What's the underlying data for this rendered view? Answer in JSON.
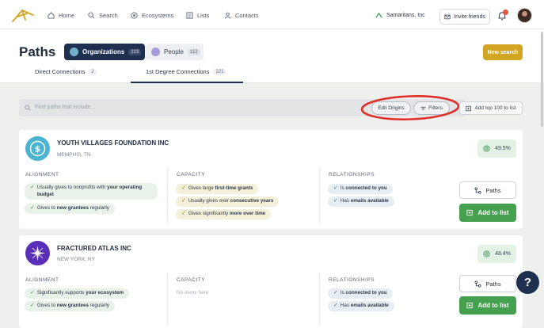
{
  "nav": {
    "items": [
      {
        "label": "Home",
        "icon": "home-icon"
      },
      {
        "label": "Search",
        "icon": "search-icon"
      },
      {
        "label": "Ecosystems",
        "icon": "ecosystems-icon"
      },
      {
        "label": "Lists",
        "icon": "lists-icon"
      },
      {
        "label": "Contacts",
        "icon": "contacts-icon"
      }
    ],
    "org_name": "Samaritans, Inc",
    "invite_label": "Invite friends",
    "notification_count": ""
  },
  "header": {
    "title": "Paths",
    "segments": [
      {
        "label": "Organizations",
        "count": "223",
        "active": true
      },
      {
        "label": "People",
        "count": "112",
        "active": false
      }
    ],
    "new_search_label": "New search",
    "tabs": [
      {
        "label": "Direct Connections",
        "count": "2",
        "active": false
      },
      {
        "label": "1st Degree Connections",
        "count": "221",
        "active": true
      }
    ]
  },
  "search": {
    "placeholder": "Find paths that include...",
    "edit_origins_label": "Edit Origins",
    "filters_label": "Filters",
    "add_top_label": "Add top 100 to list"
  },
  "columns": {
    "alignment": "ALIGNMENT",
    "capacity": "CAPACITY",
    "relationships": "RELATIONSHIPS"
  },
  "cards": [
    {
      "name": "YOUTH VILLAGES FOUNDATION INC",
      "location": "MEMPHIS, TN",
      "score": "49.5%",
      "alignment": [
        {
          "pre": "Usually gives to nonprofits with ",
          "bold": "your operating budget",
          "post": ""
        },
        {
          "pre": "Gives to ",
          "bold": "new grantees",
          "post": " regularly"
        }
      ],
      "capacity": [
        {
          "pre": "Gives large ",
          "bold": "first-time grants",
          "post": ""
        },
        {
          "pre": "Usually gives over ",
          "bold": "consecutive years",
          "post": ""
        },
        {
          "pre": "Gives significantly ",
          "bold": "more over time",
          "post": ""
        }
      ],
      "relationships": [
        {
          "pre": "Is ",
          "bold": "connected to you",
          "post": ""
        },
        {
          "pre": "Has ",
          "bold": "emails available",
          "post": ""
        }
      ],
      "paths_label": "Paths",
      "add_label": "Add to list"
    },
    {
      "name": "FRACTURED ATLAS INC",
      "location": "NEW YORK, NY",
      "score": "48.4%",
      "alignment": [
        {
          "pre": "Significantly supports ",
          "bold": "your ecosystem",
          "post": ""
        },
        {
          "pre": "Gives to ",
          "bold": "new grantees",
          "post": " regularly"
        }
      ],
      "capacity_empty": "No items here",
      "relationships": [
        {
          "pre": "Is ",
          "bold": "connected to you",
          "post": ""
        },
        {
          "pre": "Has ",
          "bold": "emails available",
          "post": ""
        }
      ],
      "paths_label": "Paths",
      "add_label": "Add to list"
    }
  ],
  "help_label": "?",
  "colors": {
    "primary": "#1e2f4f",
    "accent": "#d2a523",
    "success": "#45a04f",
    "annotation": "#e0302a"
  }
}
